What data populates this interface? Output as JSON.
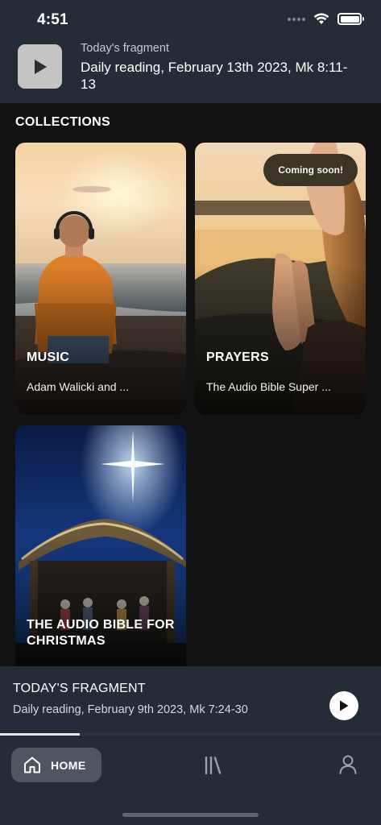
{
  "status_bar": {
    "time": "4:51",
    "icons": [
      "cellular-signal-icon",
      "wifi-icon",
      "battery-icon"
    ]
  },
  "today_header": {
    "kicker": "Today's fragment",
    "title": "Daily reading, February 13th 2023, Mk 8:11-13",
    "icon": "play-icon"
  },
  "collections": {
    "title": "COLLECTIONS",
    "items": [
      {
        "title": "MUSIC",
        "subtitle": "Adam Walicki and ...",
        "badge": ""
      },
      {
        "title": "PRAYERS",
        "subtitle": "The Audio Bible Super ...",
        "badge": "Coming soon!"
      },
      {
        "title": "THE AUDIO BIBLE FOR CHRISTMAS",
        "subtitle": "",
        "badge": ""
      }
    ]
  },
  "mini_player": {
    "title": "TODAY'S FRAGMENT",
    "subtitle": "Daily reading, February 9th 2023, Mk 7:24-30",
    "progress": 0.21,
    "icon": "play-icon"
  },
  "tab_bar": {
    "home_label": "HOME",
    "active": "home",
    "icons": [
      "home-icon",
      "library-icon",
      "profile-icon"
    ]
  },
  "colors": {
    "header_bg": "#232c37",
    "page_bg": "#121212",
    "badge_bg": "#3a3526",
    "active_tab_bg": "#4f5660"
  }
}
